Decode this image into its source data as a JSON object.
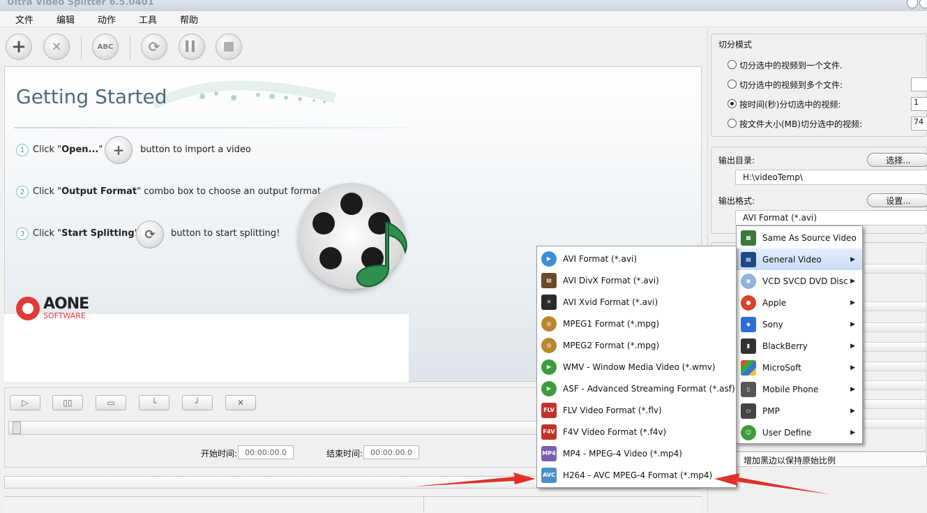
{
  "window": {
    "title": "Ultra Video Splitter 6.5.0401"
  },
  "menubar": [
    "文件",
    "编辑",
    "动作",
    "工具",
    "帮助"
  ],
  "toolbar": {
    "rename_label": "ABC"
  },
  "getting_started": {
    "title": "Getting Started",
    "steps": [
      {
        "num": "1",
        "pre": "Click \"",
        "bold": "Open...",
        "post": "\"",
        "after": "button to import a video"
      },
      {
        "num": "2",
        "pre": "Click \"",
        "bold": "Output Format",
        "post": "\" combo box to choose an output format",
        "after": ""
      },
      {
        "num": "3",
        "pre": "Click \"",
        "bold": "Start Splitting",
        "post": "\"",
        "after": "button to start splitting!"
      }
    ],
    "logo_name": "AONE",
    "logo_sub": "SOFTWARE"
  },
  "player": {
    "start_label": "开始时间:",
    "start_value": "00:00:00.0",
    "end_label": "结束时间:",
    "end_value": "00:00:00.0"
  },
  "split_mode": {
    "title": "切分模式",
    "options": [
      {
        "label": "切分选中的视频到一个文件.",
        "checked": false
      },
      {
        "label": "切分选中的视频到多个文件:",
        "checked": false
      },
      {
        "label": "按时间(秒)分切选中的视频:",
        "checked": true
      },
      {
        "label": "按文件大小(MB)切分选中的视频:",
        "checked": false
      }
    ],
    "time_value": "1",
    "size_value": "74"
  },
  "output": {
    "dir_label": "输出目录:",
    "dir_button": "选择...",
    "dir_value": "H:\\videoTemp\\",
    "format_label": "输出格式:",
    "format_button": "设置...",
    "format_value": "AVI Format (*.avi)",
    "aspect_label": "增加黑边以保持原始比例"
  },
  "category_menu": [
    {
      "label": "Same As Source Video",
      "icon": "same-source-icon",
      "submenu": false
    },
    {
      "label": "General Video",
      "icon": "film-strip-icon",
      "submenu": true,
      "highlighted": true
    },
    {
      "label": "VCD SVCD DVD Disc",
      "icon": "disc-icon",
      "submenu": true
    },
    {
      "label": "Apple",
      "icon": "apple-icon",
      "submenu": true
    },
    {
      "label": "Sony",
      "icon": "sony-icon",
      "submenu": true
    },
    {
      "label": "BlackBerry",
      "icon": "blackberry-icon",
      "submenu": true
    },
    {
      "label": "MicroSoft",
      "icon": "windows-icon",
      "submenu": true
    },
    {
      "label": "Mobile Phone",
      "icon": "mobile-phone-icon",
      "submenu": true
    },
    {
      "label": "PMP",
      "icon": "pmp-icon",
      "submenu": true
    },
    {
      "label": "User Define",
      "icon": "user-icon",
      "submenu": true
    }
  ],
  "format_menu": [
    {
      "label": "AVI Format (*.avi)",
      "icon": "avi-icon",
      "color": "#3a8fd8"
    },
    {
      "label": "AVI DivX Format (*.avi)",
      "icon": "divx-icon",
      "color": "#6b4a2a"
    },
    {
      "label": "AVI Xvid Format (*.avi)",
      "icon": "xvid-icon",
      "color": "#2a2a2a"
    },
    {
      "label": "MPEG1 Format (*.mpg)",
      "icon": "mpeg1-icon",
      "color": "#b8862e"
    },
    {
      "label": "MPEG2 Format (*.mpg)",
      "icon": "mpeg2-icon",
      "color": "#b8862e"
    },
    {
      "label": "WMV - Window Media Video (*.wmv)",
      "icon": "wmv-icon",
      "color": "#3c9b3c"
    },
    {
      "label": "ASF - Advanced Streaming Format (*.asf)",
      "icon": "asf-icon",
      "color": "#3c9b3c"
    },
    {
      "label": "FLV Video Format (*.flv)",
      "icon": "flv-icon",
      "color": "#c4322c"
    },
    {
      "label": "F4V Video Format (*.f4v)",
      "icon": "f4v-icon",
      "color": "#c4322c"
    },
    {
      "label": "MP4 - MPEG-4 Video (*.mp4)",
      "icon": "mp4-icon",
      "color": "#7a5fb0"
    },
    {
      "label": "H264 - AVC MPEG-4 Format (*.mp4)",
      "icon": "h264-icon",
      "color": "#4a90c8"
    }
  ],
  "icon_text": {
    "flv": "FLV",
    "f4v": "F4V",
    "mp4": "MP4",
    "avc": "AVC"
  },
  "colors": {
    "annotation_arrow": "#e0302a",
    "menu_highlight": "#c9dcf6",
    "logo_red": "#e23a36"
  }
}
